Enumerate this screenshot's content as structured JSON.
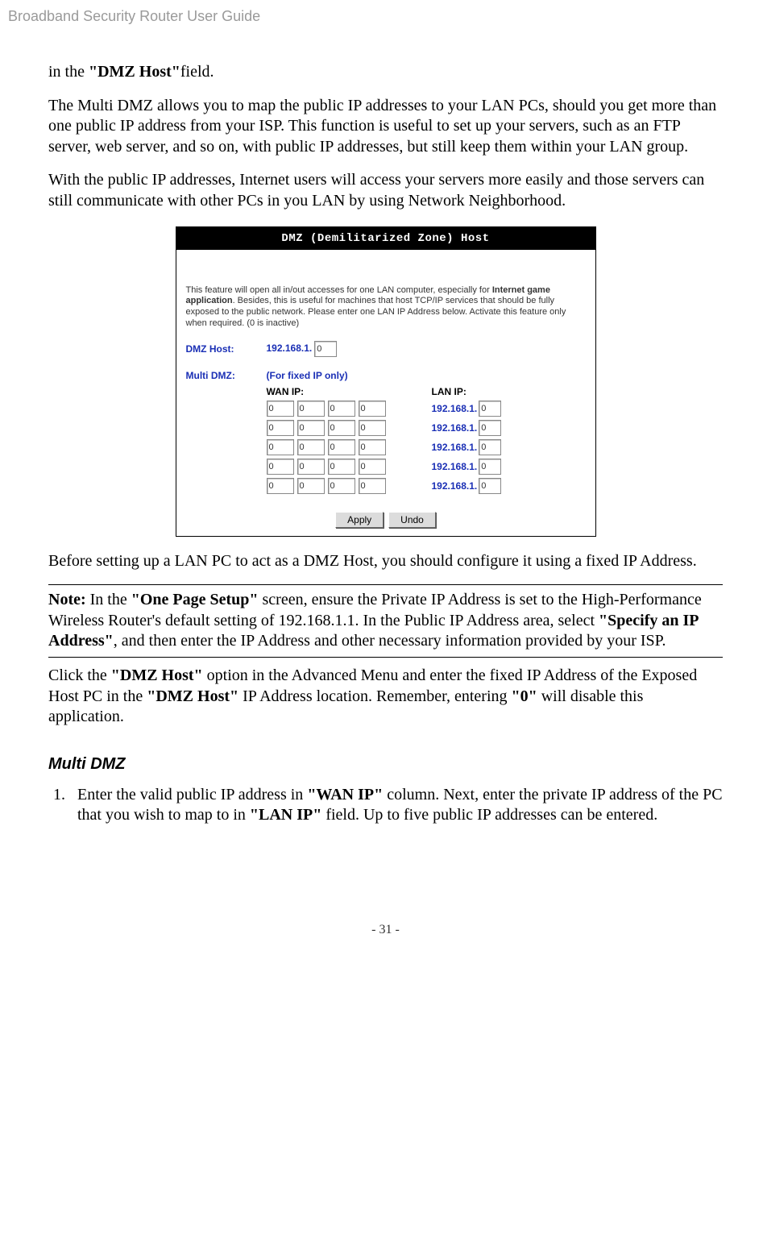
{
  "running_head": "Broadband Security Router User Guide",
  "p1_pre": "in the ",
  "p1_bold": "\"DMZ Host\"",
  "p1_post": "field.",
  "p2": "The Multi DMZ allows you to map the public IP addresses to your LAN PCs, should you get more than one public IP address from your ISP. This function is useful to set up your servers, such as an FTP server, web server, and so on, with public IP addresses, but still keep them within your LAN group.",
  "p3": "With the public IP addresses, Internet users will access your servers more easily and those servers can still communicate with other PCs in you LAN by using Network Neighborhood.",
  "fig": {
    "title": "DMZ (Demilitarized Zone) Host",
    "desc_a": "This feature will open all in/out accesses for one LAN computer, especially for ",
    "desc_bold": "Internet game application",
    "desc_b": ". Besides, this is useful for machines that host TCP/IP services that should be fully exposed to the public network. Please enter one LAN IP Address below. Activate this feature only when required. (0 is inactive)",
    "dmz_host_label": "DMZ Host:",
    "dmz_prefix": "192.168.1.",
    "dmz_value": "0",
    "multi_label": "Multi DMZ:",
    "multi_sub": "(For fixed IP only)",
    "wan_hdr": "WAN IP:",
    "lan_hdr": "LAN IP:",
    "lan_prefix": "192.168.1.",
    "zero": "0",
    "apply": "Apply",
    "undo": "Undo"
  },
  "p4": "Before setting up a LAN PC to act as a DMZ Host, you should configure it using a fixed IP Address.",
  "note": {
    "lead": "Note:",
    "a": " In the ",
    "b_bold": "\"One Page Setup\"",
    "c": " screen, ensure the Private IP Address is set to the High-Performance Wireless Router's default setting of 192.168.1.1. In the Public IP Address area, select ",
    "d_bold": "\"Specify an IP Address\"",
    "e": ", and then enter the IP Address and other necessary information provided by your ISP."
  },
  "p5": {
    "a": "Click the ",
    "b_bold": "\"DMZ Host\"",
    "c": " option in the Advanced Menu and enter the fixed IP Address of the Exposed Host PC in the ",
    "d_bold": "\"DMZ Host\"",
    "e": " IP Address location. Remember, entering ",
    "f_bold": "\"0\"",
    "g": " will disable this application."
  },
  "subhead": "Multi DMZ",
  "step1": {
    "a": "Enter the valid public IP address in ",
    "b_bold": "\"WAN IP\"",
    "c": " column. Next, enter the private IP address of the PC that you wish to map to in ",
    "d_bold": "\"LAN IP\"",
    "e": " field. Up to five public IP addresses can be entered."
  },
  "page_num": "- 31 -"
}
